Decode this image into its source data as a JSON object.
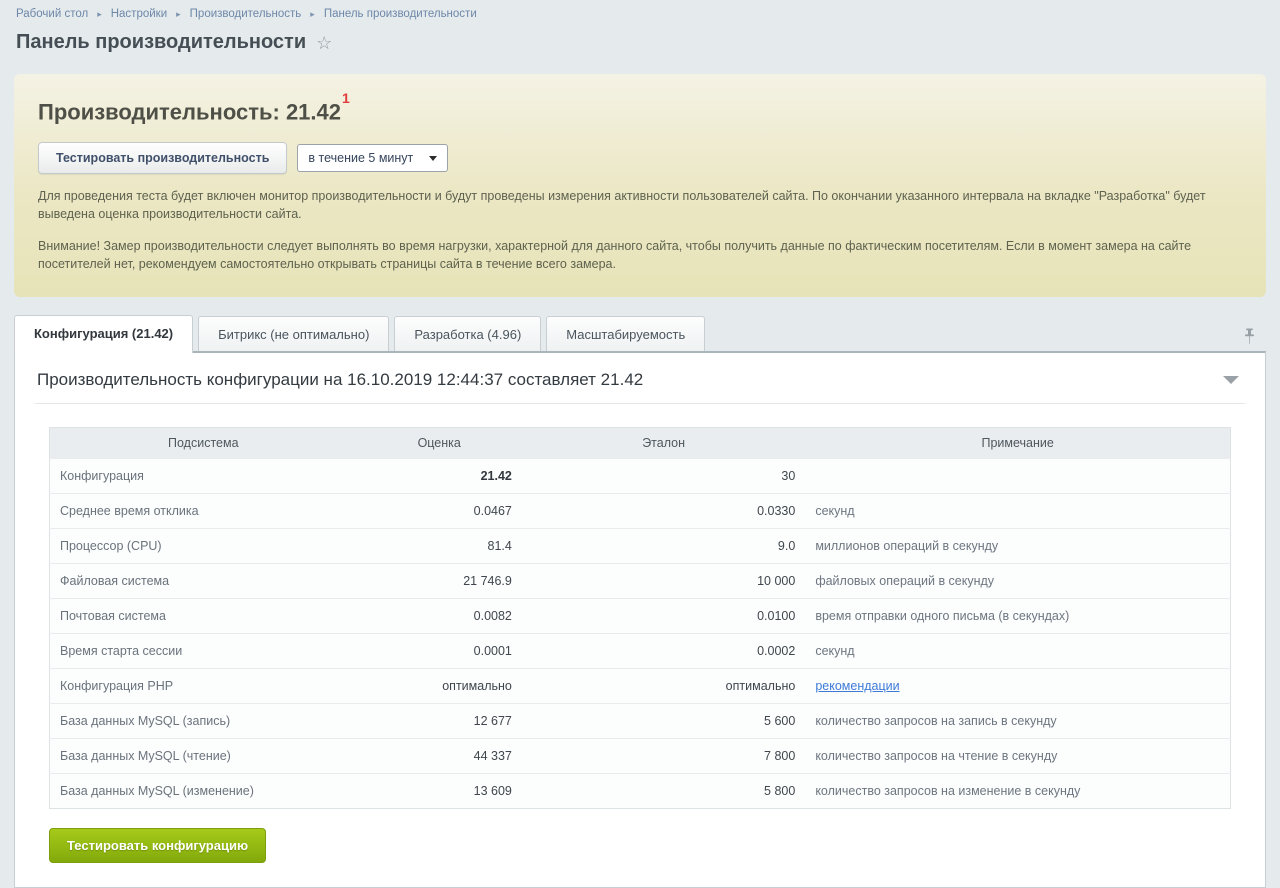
{
  "breadcrumb": {
    "items": [
      "Рабочий стол",
      "Настройки",
      "Производительность",
      "Панель производительности"
    ]
  },
  "page": {
    "title": "Панель производительности"
  },
  "perf_panel": {
    "heading": "Производительность: 21.42",
    "heading_sup": "1",
    "test_button_label": "Тестировать производительность",
    "duration_select_value": "в течение 5 минут",
    "paragraph1": "Для проведения теста будет включен монитор производительности и будут проведены измерения активности пользователей сайта. По окончании указанного интервала на вкладке \"Разработка\" будет выведена оценка производительности сайта.",
    "paragraph2": "Внимание! Замер производительности следует выполнять во время нагрузки, характерной для данного сайта, чтобы получить данные по фактическим посетителям. Если в момент замера на сайте посетителей нет, рекомендуем самостоятельно открывать страницы сайта в течение всего замера."
  },
  "tabs": [
    {
      "label": "Конфигурация (21.42)",
      "active": true
    },
    {
      "label": "Битрикс (не оптимально)",
      "active": false
    },
    {
      "label": "Разработка (4.96)",
      "active": false
    },
    {
      "label": "Масштабируемость",
      "active": false
    }
  ],
  "section": {
    "title": "Производительность конфигурации на 16.10.2019 12:44:37 составляет 21.42",
    "table": {
      "headers": [
        "Подсистема",
        "Оценка",
        "Эталон",
        "Примечание"
      ],
      "rows": [
        {
          "subsystem": "Конфигурация",
          "score": "21.42",
          "score_bold": true,
          "reference": "30",
          "note": ""
        },
        {
          "subsystem": "Среднее время отклика",
          "score": "0.0467",
          "reference": "0.0330",
          "note": "секунд"
        },
        {
          "subsystem": "Процессор (CPU)",
          "score": "81.4",
          "reference": "9.0",
          "note": "миллионов операций в секунду"
        },
        {
          "subsystem": "Файловая система",
          "score": "21 746.9",
          "reference": "10 000",
          "note": "файловых операций в секунду"
        },
        {
          "subsystem": "Почтовая система",
          "score": "0.0082",
          "reference": "0.0100",
          "note": "время отправки одного письма (в секундах)"
        },
        {
          "subsystem": "Время старта сессии",
          "score": "0.0001",
          "reference": "0.0002",
          "note": "секунд"
        },
        {
          "subsystem": "Конфигурация PHP",
          "score": "оптимально",
          "reference": "оптимально",
          "note": "рекомендации",
          "note_is_link": true
        },
        {
          "subsystem": "База данных MySQL (запись)",
          "score": "12 677",
          "reference": "5 600",
          "note": "количество запросов на запись в секунду"
        },
        {
          "subsystem": "База данных MySQL (чтение)",
          "score": "44 337",
          "reference": "7 800",
          "note": "количество запросов на чтение в секунду"
        },
        {
          "subsystem": "База данных MySQL (изменение)",
          "score": "13 609",
          "reference": "5 800",
          "note": "количество запросов на изменение в секунду"
        }
      ]
    },
    "test_config_button_label": "Тестировать конфигурацию"
  },
  "icons": {
    "favorite_star": "☆",
    "breadcrumb_separator": "▸"
  },
  "colors": {
    "page_background": "#e5ebed",
    "panel_yellow_top": "#f4f2e4",
    "panel_yellow_bottom": "#e7e3b8",
    "heading_sup_red": "#e03c3c",
    "link_blue": "#3e7bd8",
    "breadcrumb_blue": "#6d87a8",
    "green_button_top": "#a6cb1a",
    "green_button_bottom": "#82a90b",
    "table_header_bg": "#e9edf0"
  }
}
